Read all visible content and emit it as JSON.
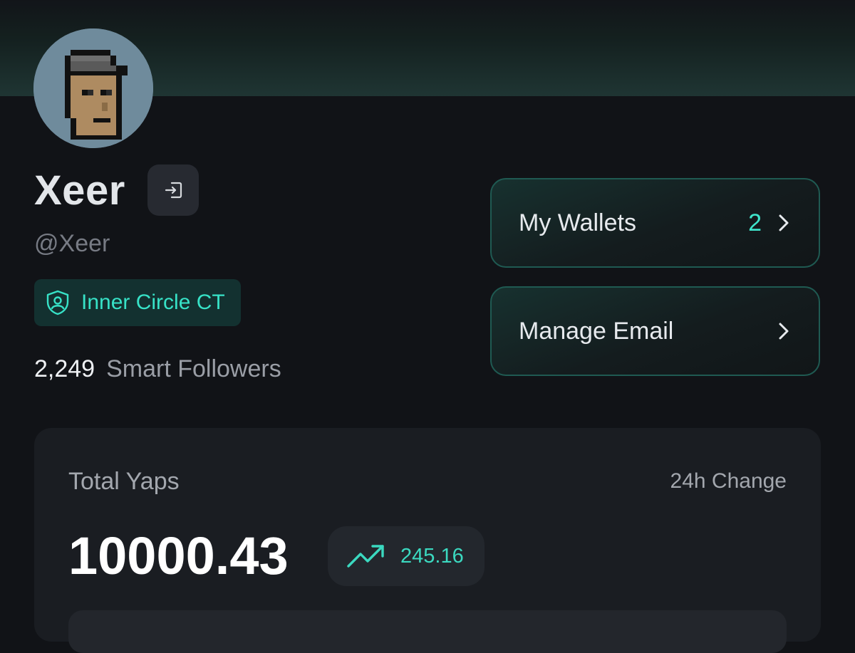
{
  "profile": {
    "name": "Xeer",
    "handle": "@Xeer",
    "badge": "Inner Circle CT",
    "smart_followers_count": "2,249",
    "smart_followers_label": "Smart Followers"
  },
  "actions": {
    "wallets_label": "My Wallets",
    "wallets_count": "2",
    "email_label": "Manage Email"
  },
  "stats": {
    "total_label": "Total Yaps",
    "change_label": "24h Change",
    "total_value": "10000.43",
    "change_value": "245.16"
  },
  "icons": {
    "login": "login-icon",
    "shield": "shield-user-icon",
    "chevron": "chevron-right-icon",
    "trend": "trending-up-icon"
  },
  "colors": {
    "accent": "#3fe6cc",
    "background": "#111317",
    "panel": "#1a1d22"
  }
}
